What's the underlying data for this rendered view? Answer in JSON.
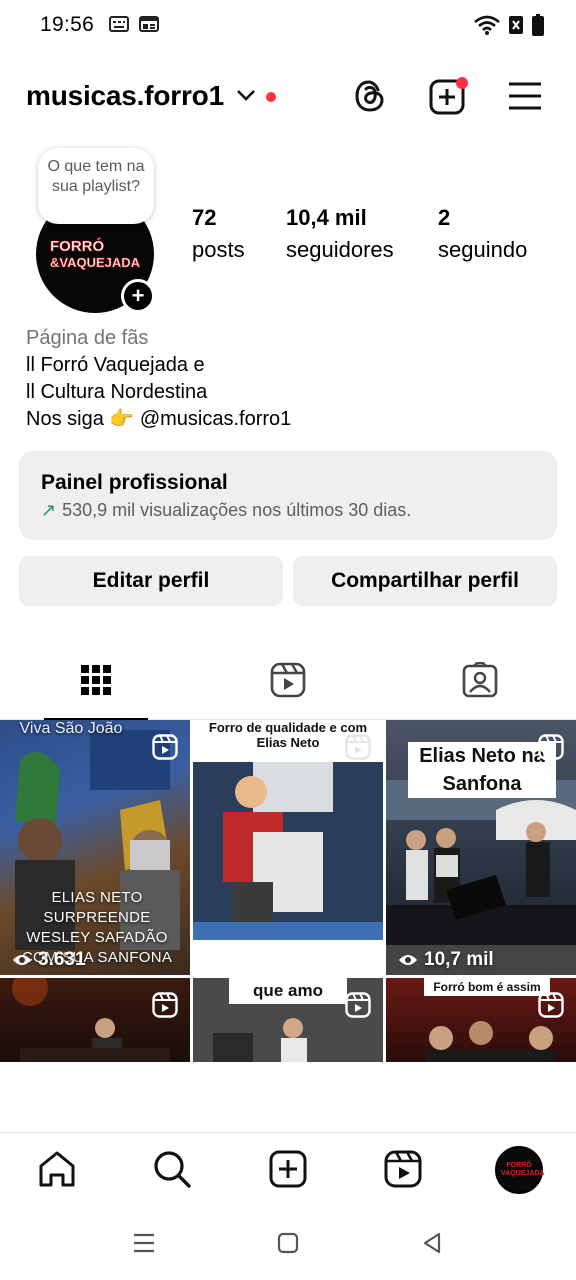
{
  "status_bar": {
    "time": "19:56"
  },
  "header": {
    "username": "musicas.forro1"
  },
  "profile": {
    "note": "O que tem na sua playlist?",
    "avatar_logo_line1": "FORRÓ",
    "avatar_logo_line2": "&VAQUEJADA",
    "stats": [
      {
        "value": "72",
        "label": "posts"
      },
      {
        "value": "10,4 mil",
        "label": "seguidores"
      },
      {
        "value": "2",
        "label": "seguindo"
      }
    ],
    "category": "Página de fãs",
    "bio_lines": [
      "ll Forró Vaquejada e",
      "ll Cultura Nordestina",
      "Nos siga 👉 @musicas.forro1"
    ]
  },
  "pro_panel": {
    "title": "Painel profissional",
    "subtitle": "530,9 mil visualizações nos últimos 30 dias."
  },
  "buttons": {
    "edit": "Editar perfil",
    "share": "Compartilhar perfil"
  },
  "grid": {
    "posts": [
      {
        "top_text": "Viva São João",
        "overlay": "ELIAS NETO SURPREENDE WESLEY SAFADÃO COM SUA SANFONA",
        "views": "3.631"
      },
      {
        "caption": "Forro de qualidade e com Elias Neto"
      },
      {
        "caption": "Elias Neto na Sanfona",
        "views": "10,7 mil"
      },
      {
        "caption": ""
      },
      {
        "caption": "que amo"
      },
      {
        "caption": "Forró bom é assim"
      }
    ]
  },
  "bottom_nav": {
    "avatar_text": "FORRÓ VAQUEJADA"
  },
  "colors": {
    "accent_red": "#ff3040",
    "panel_bg": "#efefef",
    "trend_green": "#1a9a4a"
  }
}
